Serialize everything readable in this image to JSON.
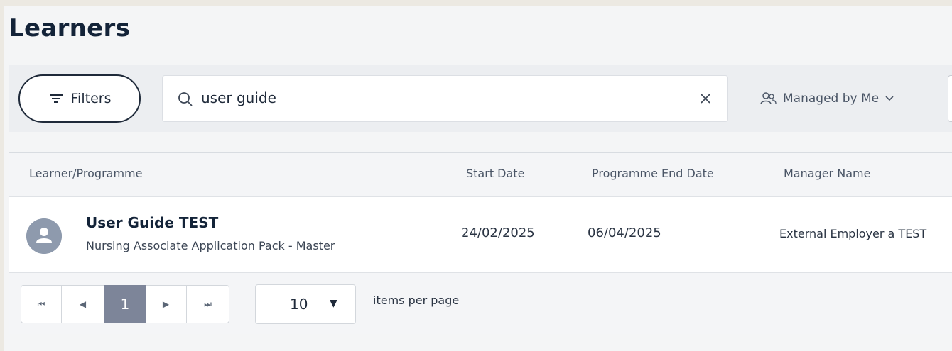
{
  "page": {
    "title": "Learners"
  },
  "toolbar": {
    "filters_label": "Filters",
    "search_value": "user guide",
    "managed_label": "Managed by Me"
  },
  "grid": {
    "columns": [
      "Learner/Programme",
      "Start Date",
      "Programme End Date",
      "Manager Name"
    ],
    "rows": [
      {
        "name": "User Guide TEST",
        "programme": "Nursing Associate Application Pack - Master",
        "start_date": "24/02/2025",
        "end_date": "06/04/2025",
        "manager": "External Employer a TEST"
      }
    ]
  },
  "pager": {
    "first": "⏮",
    "prev": "◀",
    "current_page": "1",
    "next": "▶",
    "last": "⏭",
    "page_size": "10",
    "items_per_page_label": "items per page"
  },
  "colors": {
    "current_page_bg": "#7d8599",
    "avatar": "#8e9aad",
    "title": "#132338"
  }
}
